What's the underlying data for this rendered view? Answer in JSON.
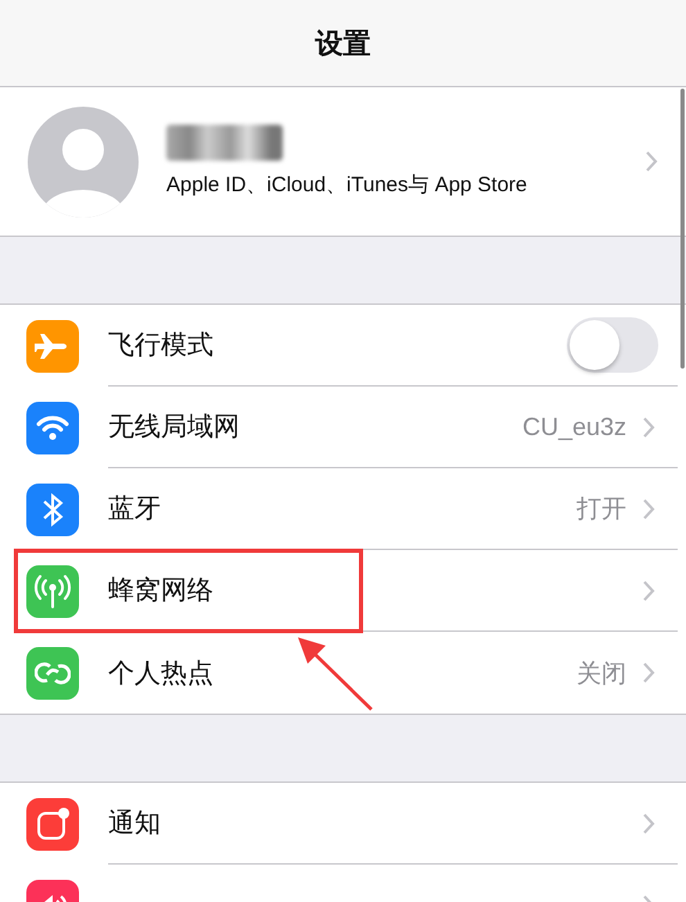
{
  "nav": {
    "title": "设置"
  },
  "profile": {
    "subtitle": "Apple ID、iCloud、iTunes与 App Store"
  },
  "groups": [
    [
      {
        "color": "#ff9500",
        "label": "飞行模式",
        "kind": "toggle",
        "on": false
      },
      {
        "color": "#1a82fb",
        "label": "无线局域网",
        "kind": "link",
        "value": "CU_eu3z"
      },
      {
        "color": "#1a82fb",
        "label": "蓝牙",
        "kind": "link",
        "value": "打开"
      },
      {
        "color": "#3ec454",
        "label": "蜂窝网络",
        "kind": "link"
      },
      {
        "color": "#3ec454",
        "label": "个人热点",
        "kind": "link",
        "value": "关闭"
      }
    ],
    [
      {
        "color": "#fc3d39",
        "label": "通知",
        "kind": "link"
      },
      {
        "color": "#fc3158",
        "kind": "link"
      }
    ]
  ]
}
